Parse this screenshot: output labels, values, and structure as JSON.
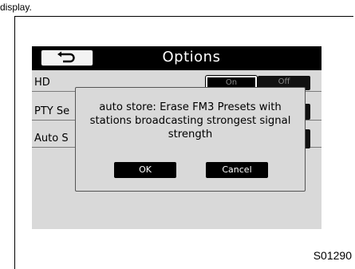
{
  "page_header_text": "display.",
  "options_screen": {
    "title": "Options",
    "back_icon": "u-turn-back-arrow-icon",
    "rows": [
      {
        "label": "HD",
        "segments": [
          "On",
          "Off"
        ]
      },
      {
        "label": "PTY Se"
      },
      {
        "label": "Auto S"
      }
    ]
  },
  "dialog": {
    "message_lines": [
      "auto store: Erase FM3 Presets with",
      "stations broadcasting strongest signal",
      "strength"
    ],
    "ok_label": "OK",
    "cancel_label": "Cancel"
  },
  "figure_code": "S01290"
}
